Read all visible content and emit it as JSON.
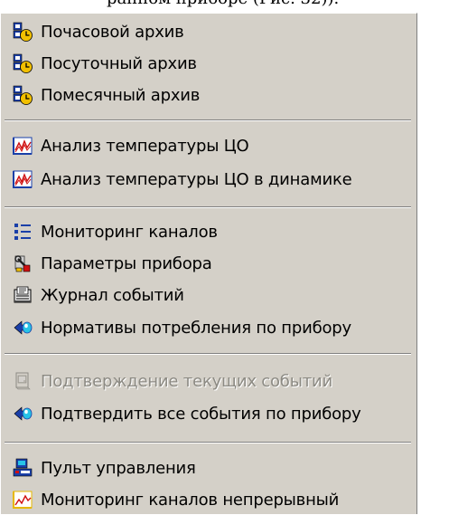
{
  "caption": "ранном приборе (Рис. 32)).",
  "menu": {
    "items": [
      {
        "label": "Почасовой архив",
        "icon": "hourly-archive-icon"
      },
      {
        "label": "Посуточный архив",
        "icon": "daily-archive-icon"
      },
      {
        "label": "Помесячный архив",
        "icon": "monthly-archive-icon"
      },
      {
        "label": "Анализ температуры ЦО",
        "icon": "temperature-chart-icon"
      },
      {
        "label": "Анализ температуры ЦО в динамике",
        "icon": "temperature-dynamics-chart-icon"
      },
      {
        "label": "Мониторинг каналов",
        "icon": "channel-list-icon"
      },
      {
        "label": "Параметры прибора",
        "icon": "device-parameters-icon"
      },
      {
        "label": "Журнал событий",
        "icon": "event-log-icon"
      },
      {
        "label": "Нормативы потребления по прибору",
        "icon": "consumption-norms-icon"
      },
      {
        "label": "Подтверждение текущих событий",
        "icon": "confirm-current-events-icon",
        "disabled": true
      },
      {
        "label": "Подтвердить все события по прибору",
        "icon": "confirm-all-events-icon"
      },
      {
        "label": "Пульт управления",
        "icon": "control-panel-icon"
      },
      {
        "label": "Мониторинг каналов непрерывный",
        "icon": "continuous-monitoring-icon"
      }
    ]
  },
  "colors": {
    "menu_background": "#d4d0c8",
    "disabled_text": "#8c8a83",
    "icon_blue": "#1a3fa8",
    "icon_yellow": "#f2c000",
    "icon_red": "#d01010",
    "icon_cyan": "#27c3e6"
  }
}
